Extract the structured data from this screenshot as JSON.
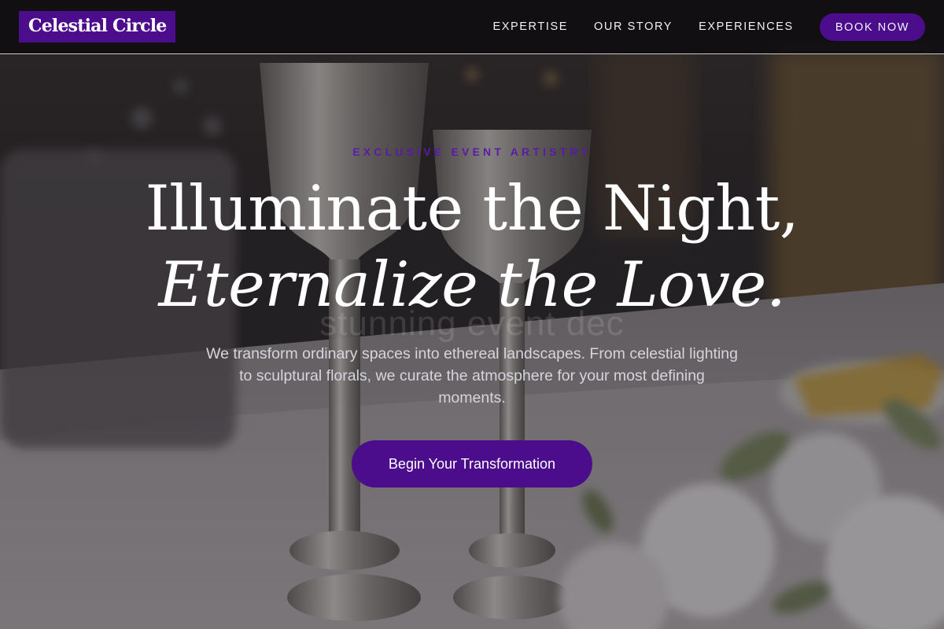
{
  "brand": {
    "name": "Celestial Circle",
    "accent": "#4b0d8c",
    "eyebrow_color": "#5b1aa6"
  },
  "nav": {
    "links": [
      "EXPERTISE",
      "OUR STORY",
      "EXPERIENCES"
    ],
    "cta_label": "BOOK NOW"
  },
  "hero": {
    "eyebrow": "EXCLUSIVE EVENT ARTISTRY",
    "headline_line1": "Illuminate the Night,",
    "headline_line2": "Eternalize the Love.",
    "ghost_text": "stunning event dec",
    "lede": "We transform ordinary spaces into ethereal landscapes. From celestial lighting to sculptural florals, we curate the atmosphere for your most defining moments.",
    "cta_label": "Begin Your Transformation"
  },
  "background": {
    "subject": "silver candle holders on a white-draped banquet table with white florals"
  }
}
